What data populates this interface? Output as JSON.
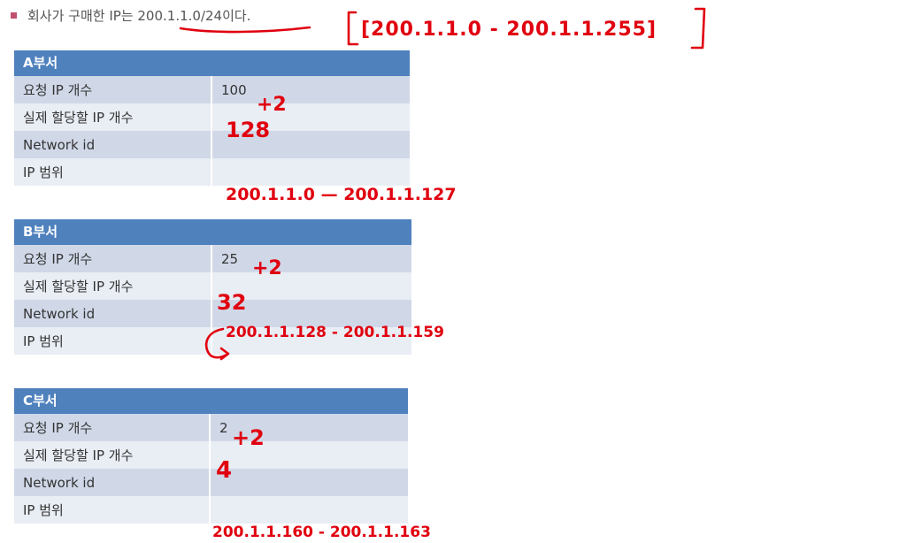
{
  "intro": {
    "text": "회사가 구매한 IP는 200.1.1.0/24이다.",
    "annotation": "[200.1.1.0 - 200.1.1.255]"
  },
  "departments": [
    {
      "title": "A부서",
      "rows": [
        {
          "label": "요청 IP 개수",
          "value": "100",
          "note": "+2"
        },
        {
          "label": "실제 할당할 IP 개수",
          "value": "",
          "note": "128"
        },
        {
          "label": "Network id",
          "value": "",
          "note": ""
        },
        {
          "label": "IP 범위",
          "value": "",
          "note": "200.1.1.0 — 200.1.1.127"
        }
      ]
    },
    {
      "title": "B부서",
      "rows": [
        {
          "label": "요청 IP 개수",
          "value": "25",
          "note": "+2"
        },
        {
          "label": "실제 할당할 IP 개수",
          "value": "",
          "note": "32"
        },
        {
          "label": "Network id",
          "value": "",
          "note": "200.1.1.128 - 200.1.1.159"
        },
        {
          "label": "IP 범위",
          "value": "",
          "note": ""
        }
      ]
    },
    {
      "title": "C부서",
      "rows": [
        {
          "label": "요청 IP 개수",
          "value": "2",
          "note": "+2"
        },
        {
          "label": "실제 할당할 IP 개수",
          "value": "",
          "note": "4"
        },
        {
          "label": "Network id",
          "value": "",
          "note": ""
        },
        {
          "label": "IP 범위",
          "value": "",
          "note": "200.1.1.160 - 200.1.1.163"
        }
      ]
    }
  ],
  "colors": {
    "header": "#4f81bd",
    "row_odd": "#d0d8e8",
    "row_even": "#e9edf4",
    "ink": "#e0000f"
  }
}
